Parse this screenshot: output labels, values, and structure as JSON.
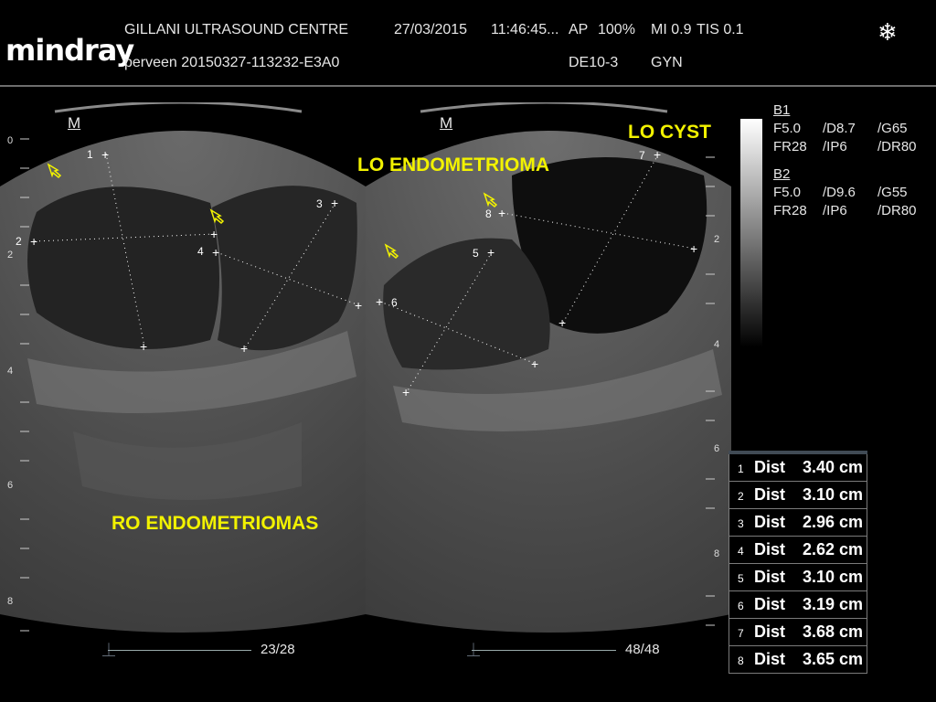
{
  "header": {
    "brand": "mindray",
    "centre": "GILLANI ULTRASOUND CENTRE",
    "date": "27/03/2015",
    "time": "11:46:45...",
    "ap": "AP",
    "power": "100%",
    "mi": "MI 0.9",
    "tis": "TIS 0.1",
    "patient": "perveen 20150327-113232-E3A0",
    "probe": "DE10-3",
    "preset": "GYN"
  },
  "icons": {
    "freeze": "snowflake-icon",
    "orientation": "m-marker-icon"
  },
  "left_panel": {
    "marker": "M",
    "label": "RO ENDOMETRIOMAS",
    "frame": "23/28",
    "depth_labels": [
      "0",
      "2",
      "4",
      "6",
      "8"
    ],
    "caliper_nums": [
      "1",
      "2",
      "3",
      "4"
    ]
  },
  "right_panel": {
    "marker": "M",
    "label_a": "LO ENDOMETRIOMA",
    "label_b": "LO CYST",
    "frame": "48/48",
    "depth_labels": [
      "2",
      "4",
      "6",
      "8"
    ],
    "caliper_nums": [
      "5",
      "6",
      "7",
      "8"
    ]
  },
  "params": {
    "b1": {
      "title": "B1",
      "f": "F5.0",
      "d": "/D8.7",
      "g": "/G65",
      "fr": "FR28",
      "ip": "/IP6",
      "dr": "/DR80"
    },
    "b2": {
      "title": "B2",
      "f": "F5.0",
      "d": "/D9.6",
      "g": "/G55",
      "fr": "FR28",
      "ip": "/IP6",
      "dr": "/DR80"
    }
  },
  "measurements": [
    {
      "n": "1",
      "label": "Dist",
      "value": "3.40 cm"
    },
    {
      "n": "2",
      "label": "Dist",
      "value": "3.10 cm"
    },
    {
      "n": "3",
      "label": "Dist",
      "value": "2.96 cm"
    },
    {
      "n": "4",
      "label": "Dist",
      "value": "2.62 cm"
    },
    {
      "n": "5",
      "label": "Dist",
      "value": "3.10 cm"
    },
    {
      "n": "6",
      "label": "Dist",
      "value": "3.19 cm"
    },
    {
      "n": "7",
      "label": "Dist",
      "value": "3.68 cm"
    },
    {
      "n": "8",
      "label": "Dist",
      "value": "3.65 cm"
    }
  ],
  "colors": {
    "annotation": "#f2f200",
    "background": "#000000",
    "text": "#e6e6e6"
  }
}
